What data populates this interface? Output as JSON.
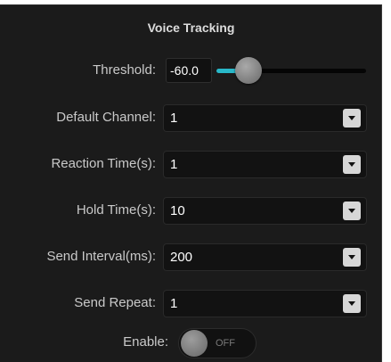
{
  "panel": {
    "title": "Voice Tracking"
  },
  "threshold": {
    "label": "Threshold:",
    "value": "-60.0",
    "slider_fraction": 0.15,
    "accent_color": "#29b8c9"
  },
  "fields": [
    {
      "label": "Default Channel:",
      "value": "1"
    },
    {
      "label": "Reaction Time(s):",
      "value": "1"
    },
    {
      "label": "Hold Time(s):",
      "value": "10"
    },
    {
      "label": "Send Interval(ms):",
      "value": "200"
    },
    {
      "label": "Send Repeat:",
      "value": "1"
    }
  ],
  "enable": {
    "label": "Enable:",
    "state_text": "OFF",
    "on": false
  }
}
